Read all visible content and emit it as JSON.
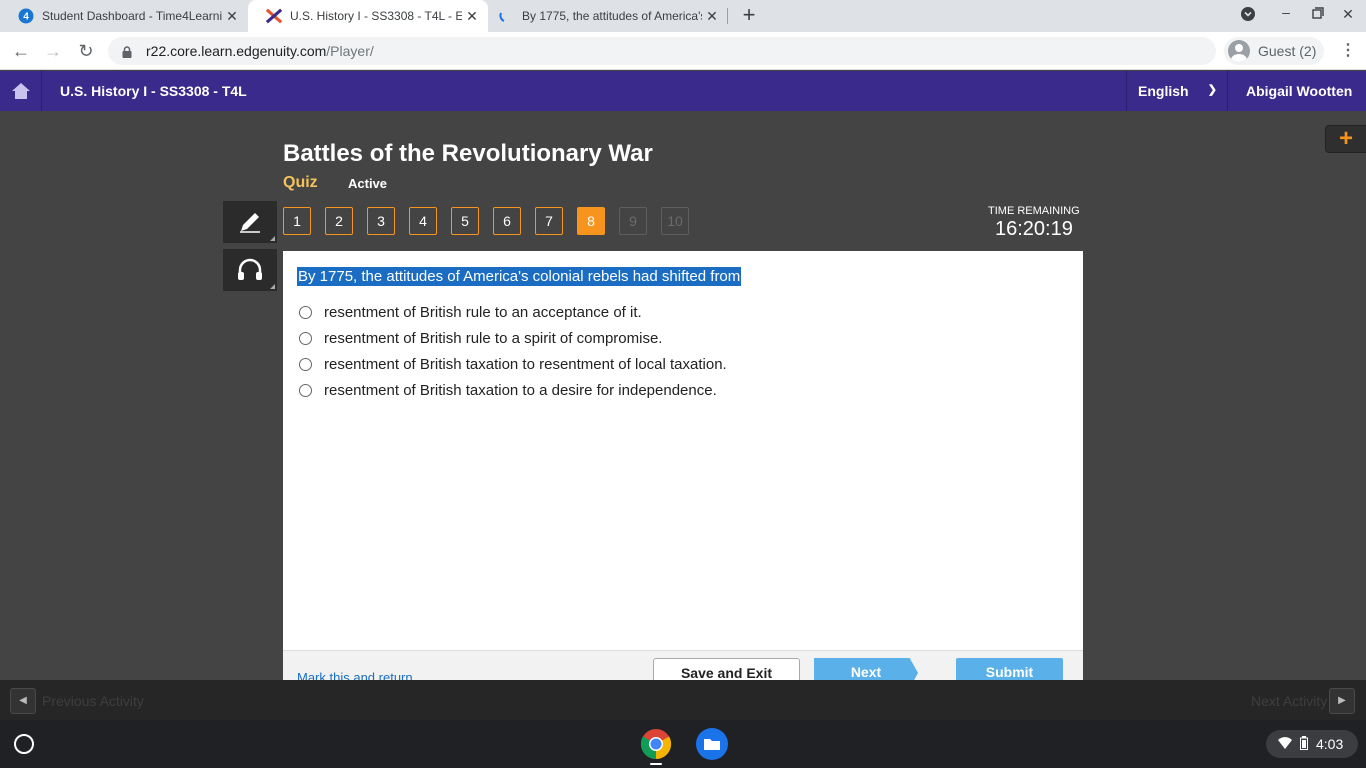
{
  "browser": {
    "tabs": [
      {
        "title": "Student Dashboard - Time4Learning",
        "active": false
      },
      {
        "title": "U.S. History I - SS3308 - T4L - Edgenuity",
        "active": true
      },
      {
        "title": "By 1775, the attitudes of America's",
        "active": false
      }
    ],
    "url_host": "r22.core.learn.edgenuity.com",
    "url_path": "/Player/",
    "profile_label": "Guest (2)"
  },
  "app": {
    "course_title": "U.S. History I - SS3308 - T4L",
    "language": "English",
    "user_name": "Abigail Wootten"
  },
  "lesson": {
    "title": "Battles of the Revolutionary War",
    "type_label": "Quiz",
    "status": "Active"
  },
  "question_nav": [
    {
      "label": "1",
      "state": "done"
    },
    {
      "label": "2",
      "state": "done"
    },
    {
      "label": "3",
      "state": "done"
    },
    {
      "label": "4",
      "state": "done"
    },
    {
      "label": "5",
      "state": "done"
    },
    {
      "label": "6",
      "state": "done"
    },
    {
      "label": "7",
      "state": "done"
    },
    {
      "label": "8",
      "state": "current"
    },
    {
      "label": "9",
      "state": "locked"
    },
    {
      "label": "10",
      "state": "locked"
    }
  ],
  "timer": {
    "label": "TIME REMAINING",
    "value": "16:20:19"
  },
  "question": {
    "text": "By 1775, the attitudes of America's colonial rebels had shifted from",
    "options": [
      "resentment of British rule to an acceptance of it.",
      "resentment of British rule to a spirit of compromise.",
      "resentment of British taxation to resentment of local taxation.",
      "resentment of British taxation to a desire for independence."
    ]
  },
  "footer": {
    "mark_label": "Mark this and return",
    "save_label": "Save and Exit",
    "next_label": "Next",
    "submit_label": "Submit"
  },
  "activity_bar": {
    "prev_label": "Previous Activity",
    "next_label": "Next Activity"
  },
  "system": {
    "clock": "4:03"
  },
  "colors": {
    "header_purple": "#3a2a8c",
    "accent_orange": "#f7941d",
    "button_blue": "#5ab0e8",
    "highlight_blue": "#1a6dc2"
  }
}
